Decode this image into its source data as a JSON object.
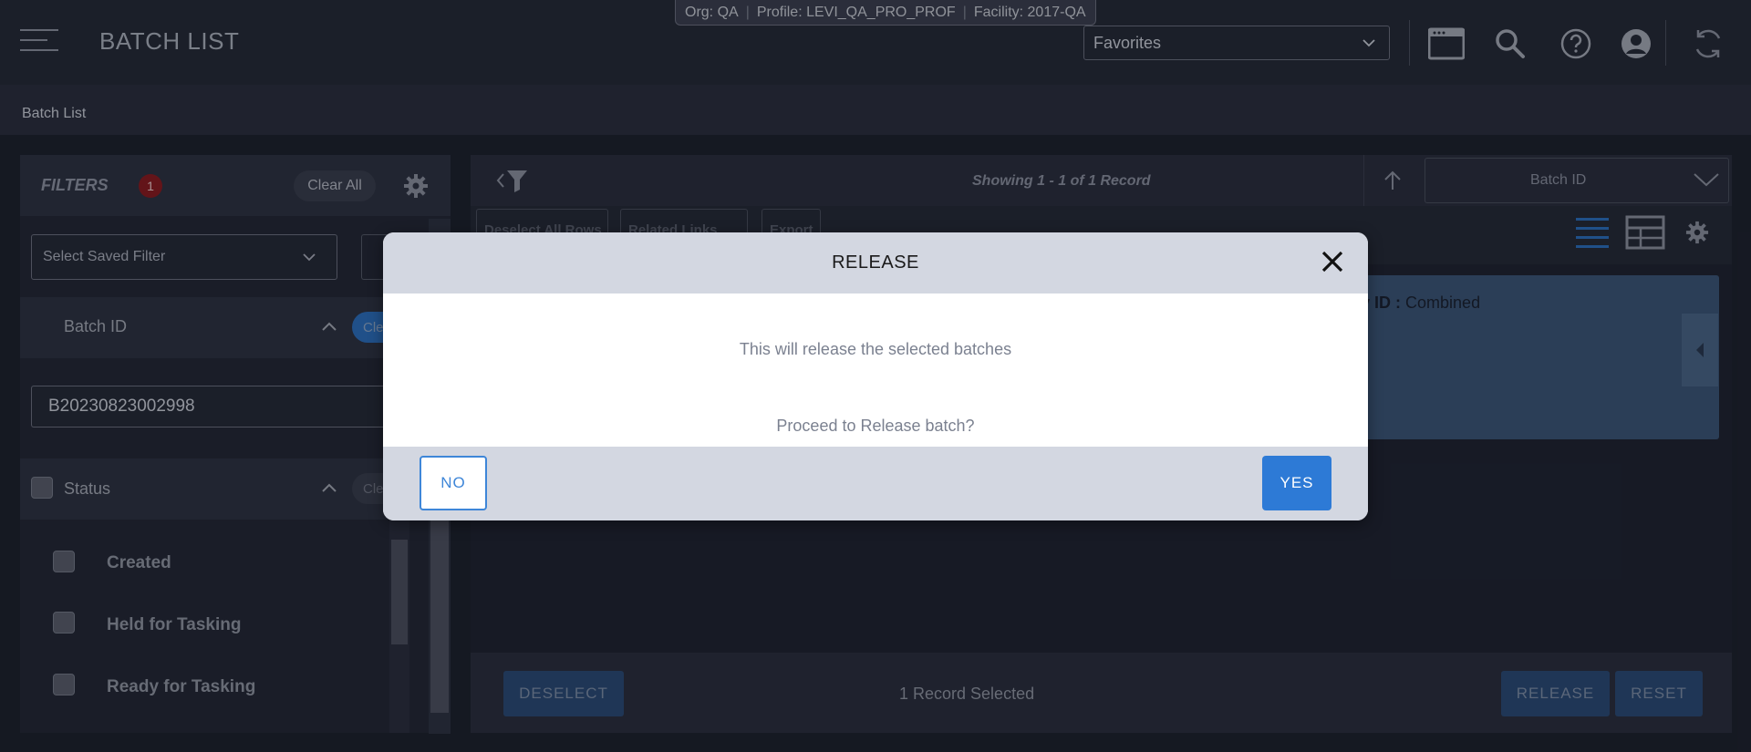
{
  "context_bar": {
    "org": "Org: QA",
    "profile": "Profile: LEVI_QA_PRO_PROF",
    "facility": "Facility: 2017-QA",
    "separator": "|"
  },
  "header": {
    "title": "BATCH LIST",
    "favorites_value": "Favorites",
    "icons": [
      "menu-icon",
      "window-icon",
      "search-icon",
      "help-icon",
      "user-icon",
      "refresh-icon"
    ]
  },
  "breadcrumb": {
    "current": "Batch List"
  },
  "filters": {
    "title": "FILTERS",
    "badge_count": "1",
    "clear_all_label": "Clear All",
    "saved_filter_placeholder": "Select Saved Filter",
    "batch_id_section": {
      "label": "Batch ID",
      "clear_label": "Cle",
      "value": "B20230823002998"
    },
    "status_section": {
      "label": "Status",
      "clear_label": "Cle",
      "items": [
        {
          "label": "Created"
        },
        {
          "label": "Held for Tasking"
        },
        {
          "label": "Ready for Tasking"
        }
      ]
    }
  },
  "results": {
    "showing": "Showing 1 - 1 of 1 Record",
    "sort_by": "Batch ID",
    "toolbar": {
      "deselect_all_rows": "Deselect All Rows",
      "related_links": "Related Links",
      "export": "Export"
    },
    "card": {
      "field_label_fragment": "y ID :",
      "field_value": "Combined"
    }
  },
  "action_bar": {
    "deselect_label": "DESELECT",
    "selected_count": "1 Record Selected",
    "release_label": "RELEASE",
    "reset_label": "RESET"
  },
  "modal": {
    "title": "RELEASE",
    "message": "This will release the selected batches",
    "question": "Proceed to Release batch?",
    "no_label": "NO",
    "yes_label": "YES"
  },
  "colors": {
    "accent_blue": "#2d7ad6",
    "card_blue": "#3c5779",
    "badge_red": "#8a1d23"
  }
}
